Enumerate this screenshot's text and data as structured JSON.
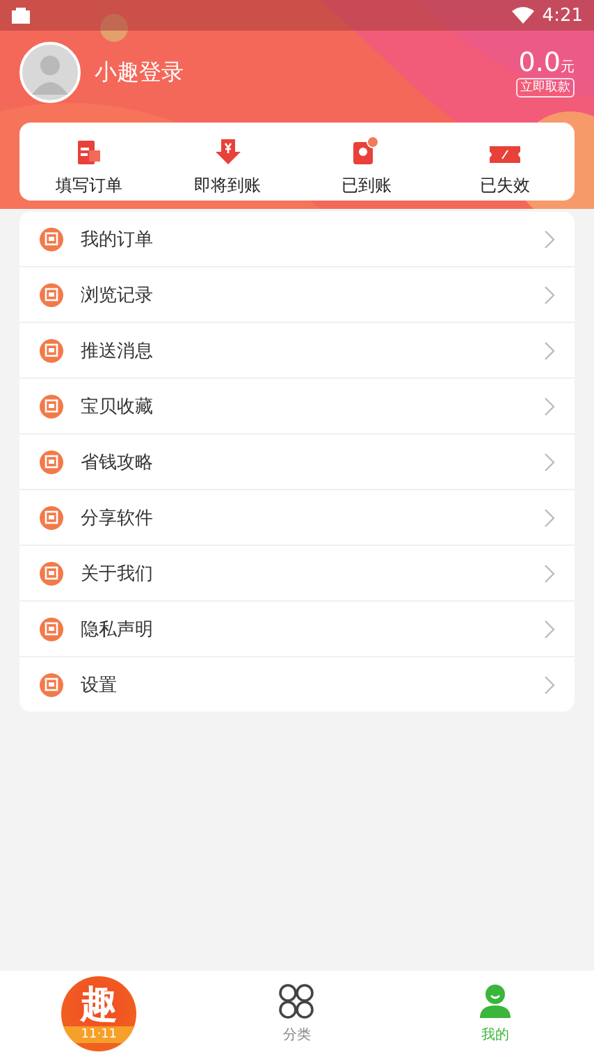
{
  "status_bar": {
    "time": "4:21"
  },
  "profile": {
    "name": "小趣登录",
    "balance": "0.0",
    "unit": "元",
    "withdraw_button": "立即取款"
  },
  "order_stats": [
    {
      "label": "填写订单",
      "kind": "form"
    },
    {
      "label": "即将到账",
      "kind": "arrive"
    },
    {
      "label": "已到账",
      "kind": "received"
    },
    {
      "label": "已失效",
      "kind": "expired"
    }
  ],
  "menu": [
    {
      "label": "我的订单"
    },
    {
      "label": "浏览记录"
    },
    {
      "label": "推送消息"
    },
    {
      "label": "宝贝收藏"
    },
    {
      "label": "省钱攻略"
    },
    {
      "label": "分享软件"
    },
    {
      "label": "关于我们"
    },
    {
      "label": "隐私声明"
    },
    {
      "label": "设置"
    }
  ],
  "bottom_nav": [
    {
      "kind": "logo",
      "label": "趣",
      "sublabel": "11·11",
      "selected": false
    },
    {
      "kind": "category",
      "label": "分类",
      "selected": false
    },
    {
      "kind": "mine",
      "label": "我的",
      "selected": true
    }
  ]
}
